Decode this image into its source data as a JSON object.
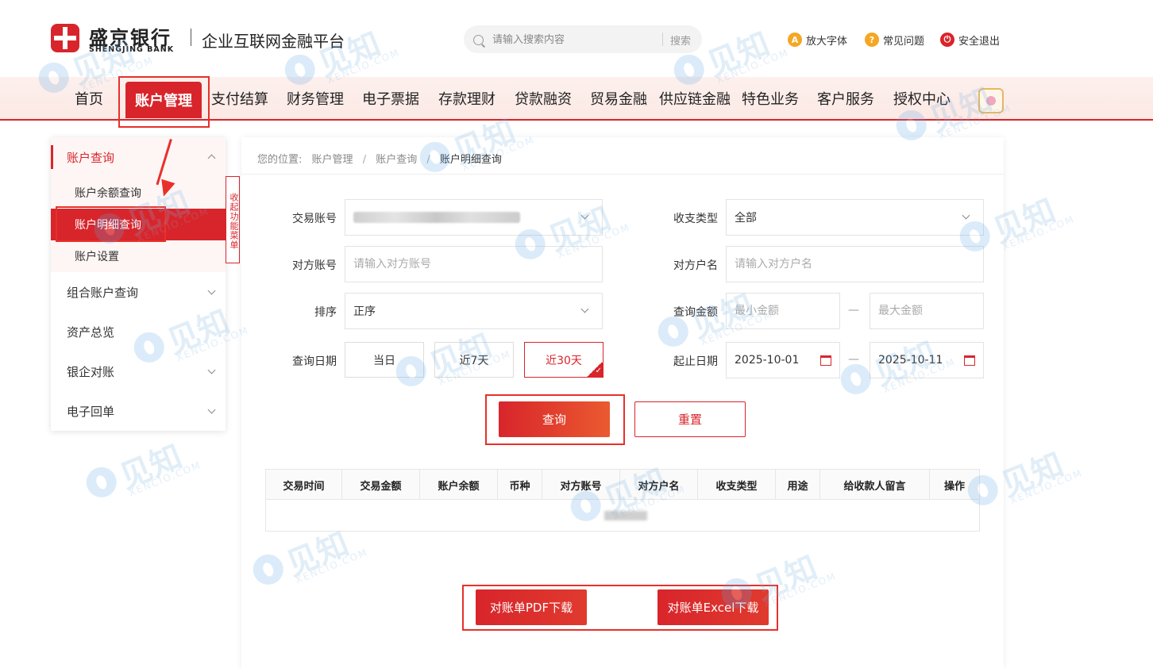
{
  "header": {
    "bank_name_cn": "盛京银行",
    "bank_name_en": "SHENGJING BANK",
    "platform_name": "企业互联网金融平台",
    "search": {
      "placeholder": "请输入搜索内容",
      "button_label": "搜索"
    },
    "utilities": [
      {
        "label": "放大字体",
        "icon": "font-size-icon",
        "glyph": "A",
        "color": "#f5a623"
      },
      {
        "label": "常见问题",
        "icon": "help-icon",
        "glyph": "?",
        "color": "#f5a623"
      },
      {
        "label": "安全退出",
        "icon": "logout-icon",
        "glyph": "⏻",
        "color": "#d8252b"
      }
    ]
  },
  "nav": {
    "items": [
      "首页",
      "账户管理",
      "支付结算",
      "财务管理",
      "电子票据",
      "存款理财",
      "贷款融资",
      "贸易金融",
      "供应链金融",
      "特色业务",
      "客户服务",
      "授权中心"
    ],
    "active_index": 1
  },
  "sidebar": {
    "groups": [
      {
        "label": "账户查询",
        "expanded": true,
        "active": true,
        "children": [
          {
            "label": "账户余额查询",
            "active": false
          },
          {
            "label": "账户明细查询",
            "active": true
          },
          {
            "label": "账户设置",
            "active": false
          }
        ]
      },
      {
        "label": "组合账户查询"
      },
      {
        "label": "资产总览"
      },
      {
        "label": "银企对账"
      },
      {
        "label": "电子回单"
      }
    ],
    "collapse_label": "收起功能菜单"
  },
  "breadcrumb": {
    "prefix": "您的位置:",
    "items": [
      "账户管理",
      "账户查询",
      "账户明细查询"
    ]
  },
  "form": {
    "account_label": "交易账号",
    "type_label": "收支类型",
    "type_value": "全部",
    "counter_account_label": "对方账号",
    "counter_account_placeholder": "请输入对方账号",
    "counter_name_label": "对方户名",
    "counter_name_placeholder": "请输入对方户名",
    "sort_label": "排序",
    "sort_value": "正序",
    "amount_label": "查询金额",
    "amount_min_placeholder": "最小金额",
    "amount_max_placeholder": "最大金额",
    "date_label": "查询日期",
    "date_quick": [
      "当日",
      "近7天",
      "近30天"
    ],
    "date_quick_active": 2,
    "range_label": "起止日期",
    "start_date": "2025-10-01",
    "end_date": "2025-10-11",
    "separator": "—",
    "query_button": "查询",
    "reset_button": "重置"
  },
  "table": {
    "columns": [
      "交易时间",
      "交易金额",
      "账户余额",
      "币种",
      "对方账号",
      "对方户名",
      "收支类型",
      "用途",
      "给收款人留言",
      "操作"
    ]
  },
  "downloads": {
    "pdf_button": "对账单PDF下载",
    "excel_button": "对账单Excel下载"
  },
  "watermark": {
    "text": "见知",
    "sub": "XENCIO.COM"
  },
  "colors": {
    "brand": "#d8252b",
    "accent_orange": "#ea5a30",
    "highlight": "#e8302a",
    "watermark": "#7ab3e2"
  }
}
